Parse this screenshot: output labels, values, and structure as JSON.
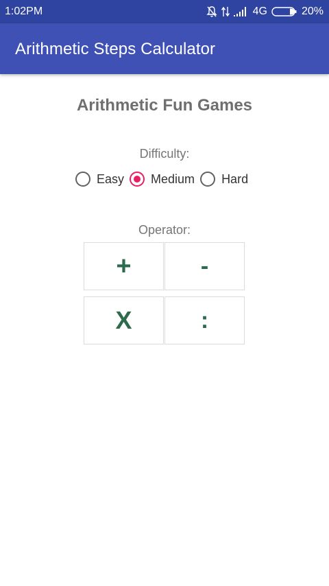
{
  "status_bar": {
    "time": "1:02PM",
    "network": "4G",
    "battery": "20%",
    "icons": [
      "bell-off-icon",
      "data-transfer-icon",
      "signal-icon",
      "battery-icon"
    ]
  },
  "app_bar": {
    "title": "Arithmetic Steps Calculator",
    "background": "#3f51b5"
  },
  "main": {
    "title": "Arithmetic Fun Games",
    "difficulty": {
      "label": "Difficulty:",
      "options": [
        {
          "label": "Easy",
          "selected": false
        },
        {
          "label": "Medium",
          "selected": true
        },
        {
          "label": "Hard",
          "selected": false
        }
      ]
    },
    "operator": {
      "label": "Operator:",
      "buttons": [
        {
          "label": "+"
        },
        {
          "label": "-"
        },
        {
          "label": "X"
        },
        {
          "label": ":"
        }
      ]
    }
  },
  "colors": {
    "accent": "#e91e63",
    "operator_text": "#2e6b4c",
    "status_bar": "#2f43a0"
  }
}
